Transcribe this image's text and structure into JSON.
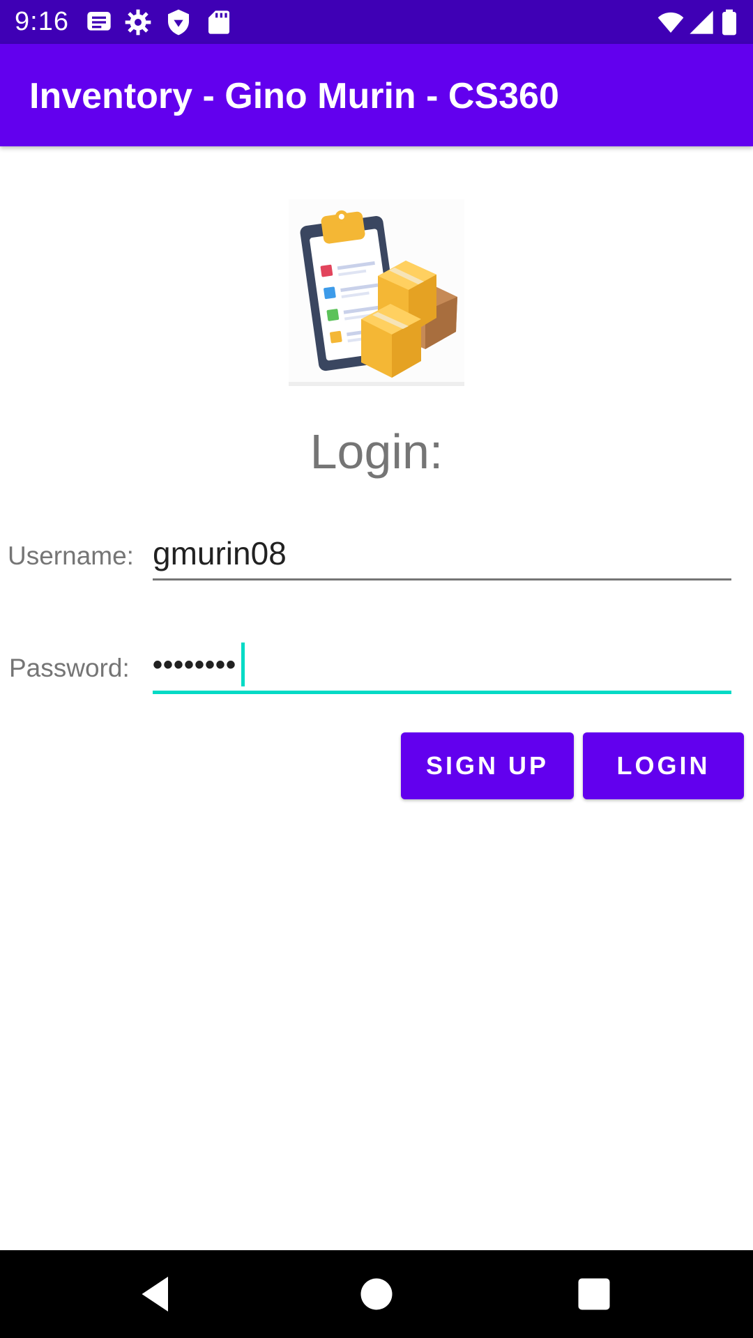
{
  "status_bar": {
    "time": "9:16",
    "icons": [
      "message-icon",
      "settings-icon",
      "shield-icon",
      "sd-card-icon",
      "wifi-icon",
      "signal-icon",
      "battery-icon"
    ]
  },
  "app_bar": {
    "title": "Inventory - Gino Murin - CS360"
  },
  "logo": {
    "icon": "inventory-clipboard-boxes-icon"
  },
  "login": {
    "heading": "Login:",
    "username_label": "Username:",
    "username_value": "gmurin08",
    "password_label": "Password:",
    "password_value": "••••••••",
    "signup_label": "SIGN UP",
    "login_label": "LOGIN"
  },
  "nav_bar": {
    "icons": [
      "back-icon",
      "home-icon",
      "recents-icon"
    ]
  },
  "colors": {
    "status_bar": "#3f00b5",
    "primary": "#6200ee",
    "accent": "#03dac5",
    "label": "#757575"
  }
}
